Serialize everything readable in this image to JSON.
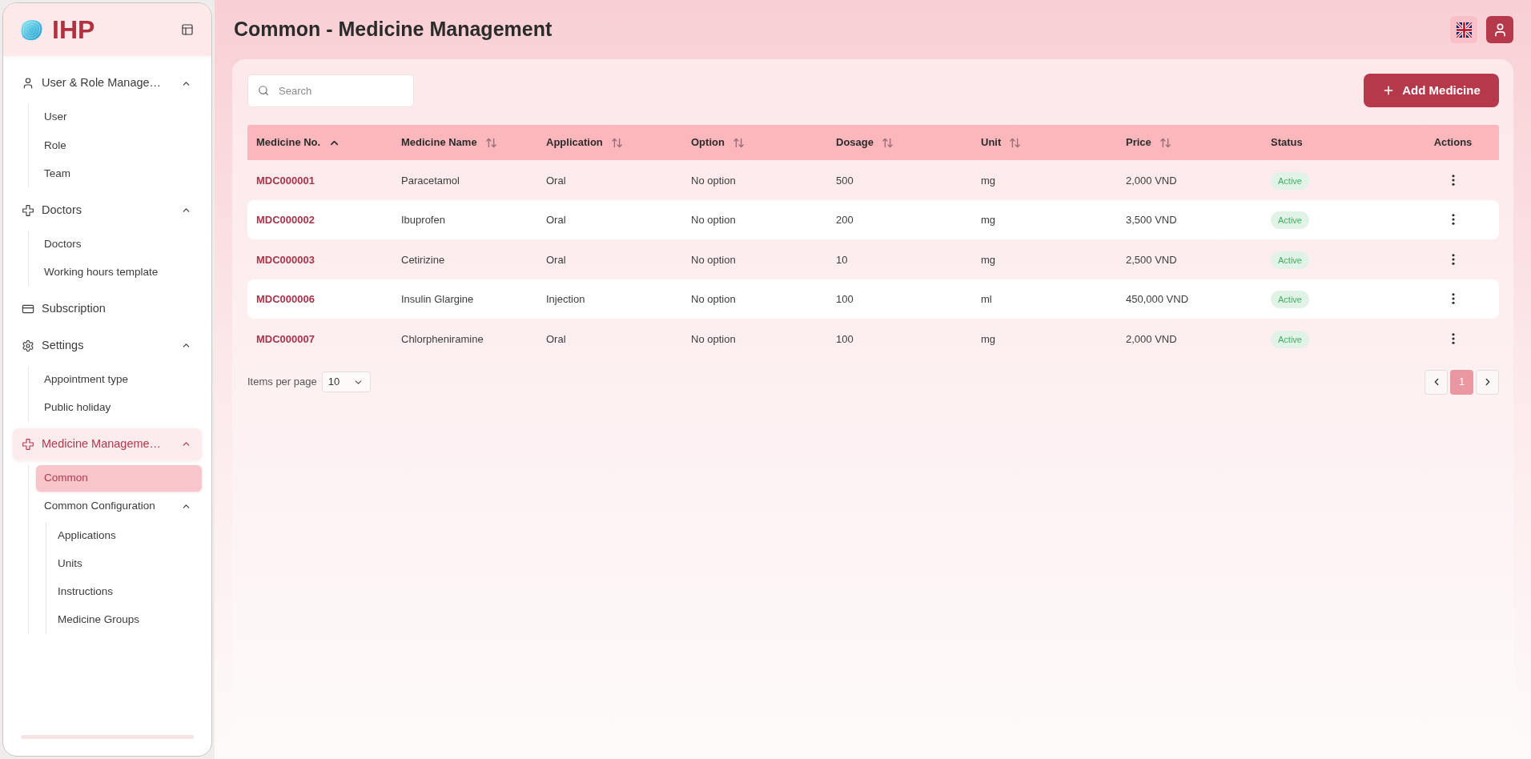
{
  "sidebar": {
    "brand": "IHP",
    "items": [
      {
        "label": "User & Role Manage…",
        "selected": false,
        "expanded": true,
        "children": [
          {
            "label": "User",
            "selected": false
          },
          {
            "label": "Role",
            "selected": false
          },
          {
            "label": "Team",
            "selected": false
          }
        ]
      },
      {
        "label": "Doctors",
        "selected": false,
        "expanded": true,
        "children": [
          {
            "label": "Doctors",
            "selected": false
          },
          {
            "label": "Working hours template",
            "selected": false
          }
        ]
      },
      {
        "label": "Subscription",
        "selected": false
      },
      {
        "label": "Settings",
        "selected": false,
        "expanded": true,
        "children": [
          {
            "label": "Appointment type",
            "selected": false
          },
          {
            "label": "Public holiday",
            "selected": false
          }
        ]
      },
      {
        "label": "Medicine Manageme…",
        "selected": true,
        "expanded": true,
        "children": [
          {
            "label": "Common",
            "selected": true
          },
          {
            "label": "Common Configuration",
            "selected": false,
            "expanded": true,
            "children": [
              {
                "label": "Applications",
                "selected": false
              },
              {
                "label": "Units",
                "selected": false
              },
              {
                "label": "Instructions",
                "selected": false
              },
              {
                "label": "Medicine Groups",
                "selected": false
              }
            ]
          }
        ]
      }
    ]
  },
  "header": {
    "title": "Common - Medicine Management"
  },
  "toolbar": {
    "search": {
      "placeholder": "Search"
    },
    "add_button": {
      "label": "Add Medicine"
    }
  },
  "table": {
    "columns": [
      {
        "label": "Medicine No.",
        "sortable": true,
        "sorted": true
      },
      {
        "label": "Medicine Name",
        "sortable": true,
        "sorted": false
      },
      {
        "label": "Application",
        "sortable": true,
        "sorted": false
      },
      {
        "label": "Option",
        "sortable": true,
        "sorted": false
      },
      {
        "label": "Dosage",
        "sortable": true,
        "sorted": false
      },
      {
        "label": "Unit",
        "sortable": true,
        "sorted": false
      },
      {
        "label": "Price",
        "sortable": true,
        "sorted": false
      },
      {
        "label": "Status",
        "sortable": false,
        "sorted": false
      },
      {
        "label": "Actions",
        "sortable": false,
        "sorted": false
      }
    ],
    "rows": [
      {
        "medicine_no": "MDC000001",
        "medicine_name": "Paracetamol",
        "application": "Oral",
        "option": "No option",
        "dosage": "500",
        "unit": "mg",
        "price": "2,000 VND",
        "status": "Active"
      },
      {
        "medicine_no": "MDC000002",
        "medicine_name": "Ibuprofen",
        "application": "Oral",
        "option": "No option",
        "dosage": "200",
        "unit": "mg",
        "price": "3,500 VND",
        "status": "Active"
      },
      {
        "medicine_no": "MDC000003",
        "medicine_name": "Cetirizine",
        "application": "Oral",
        "option": "No option",
        "dosage": "10",
        "unit": "mg",
        "price": "2,500 VND",
        "status": "Active"
      },
      {
        "medicine_no": "MDC000006",
        "medicine_name": "Insulin Glargine",
        "application": "Injection",
        "option": "No option",
        "dosage": "100",
        "unit": "ml",
        "price": "450,000 VND",
        "status": "Active"
      },
      {
        "medicine_no": "MDC000007",
        "medicine_name": "Chlorpheniramine",
        "application": "Oral",
        "option": "No option",
        "dosage": "100",
        "unit": "mg",
        "price": "2,000 VND",
        "status": "Active"
      }
    ]
  },
  "pagination": {
    "items_per_page_label": "Items per page",
    "page_size": "10",
    "pages": [
      {
        "label": "1",
        "selected": true
      }
    ]
  }
}
